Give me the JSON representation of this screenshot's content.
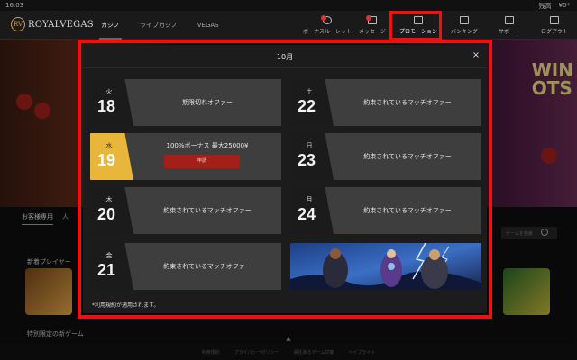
{
  "status_bar": {
    "time": "16:03",
    "balance_label": "残高",
    "balance_value": "¥0*"
  },
  "header": {
    "brand": "ROYALVEGAS",
    "crest": "RV",
    "tabs": [
      {
        "label": "カジノ"
      },
      {
        "label": "ライブカジノ"
      },
      {
        "label": "VEGAS"
      }
    ],
    "nav": {
      "bonus_wheel": "ボーナスルーレット",
      "messages": "メッセージ",
      "promotions": "プロモーション",
      "banking": "バンキング",
      "support": "サポート",
      "logout": "ログアウト"
    }
  },
  "background": {
    "banner_text": "WIN\nOTS",
    "subtabs": [
      {
        "label": "お客様専用"
      },
      {
        "label": "人"
      }
    ],
    "search_placeholder": "ゲームを検索",
    "section_new": "新着プレイヤー",
    "section_exclusive": "特別限定の新ゲーム",
    "footer_links": [
      "利用規約",
      "プライバシーポリシー",
      "責任あるゲーム対策",
      "ヘイプライト"
    ]
  },
  "modal": {
    "title": "10月",
    "close_glyph": "×",
    "cards": [
      {
        "weekday": "火",
        "day": "18",
        "offer": "期限切れオファー"
      },
      {
        "weekday": "土",
        "day": "22",
        "offer": "約束されているマッチオファー"
      },
      {
        "weekday": "水",
        "day": "19",
        "offer": "100%ボーナス 最大25000¥",
        "button": "申請",
        "highlighted": true
      },
      {
        "weekday": "日",
        "day": "23",
        "offer": "約束されているマッチオファー"
      },
      {
        "weekday": "木",
        "day": "20",
        "offer": "約束されているマッチオファー"
      },
      {
        "weekday": "月",
        "day": "24",
        "offer": "約束されているマッチオファー"
      },
      {
        "weekday": "金",
        "day": "21",
        "offer": "約束されているマッチオファー"
      }
    ],
    "terms": "*利用規約が適用されます。"
  },
  "colors": {
    "highlight": "#ee1111",
    "gold": "#e8b63b",
    "apply_button": "#a31f17",
    "card": "#3e3e3e",
    "modal": "#1c1c1c"
  }
}
